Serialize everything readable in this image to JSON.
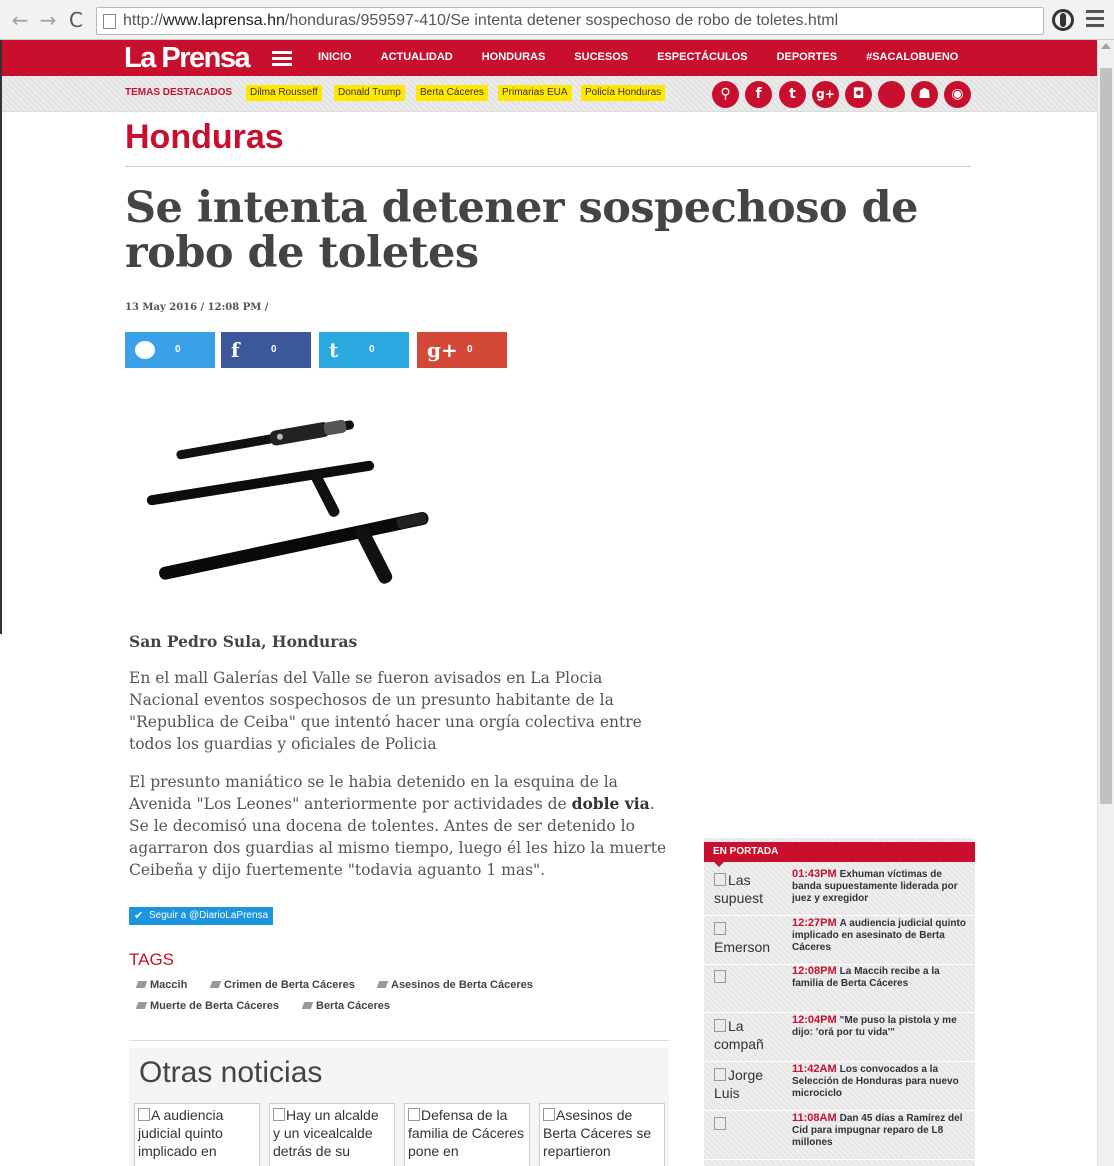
{
  "browser": {
    "url_prefix": "http://",
    "url_host": "www.laprensa.hn",
    "url_path": "/honduras/959597-410/Se intenta detener sospechoso de robo de toletes.html",
    "back": "←",
    "forward": "→",
    "reload": "C"
  },
  "site": {
    "logo": "La Prensa",
    "menu": [
      "INICIO",
      "ACTUALIDAD",
      "HONDURAS",
      "SUCESOS",
      "ESPECTÁCULOS",
      "DEPORTES",
      "#SACALOBUENO"
    ],
    "topics_label": "TEMAS DESTACADOS",
    "topics": [
      "Dilma Rousseff",
      "Donald Trump",
      "Berta Cáceres",
      "Primarias EUA",
      "Policía Honduras"
    ],
    "social_icons": [
      "search-icon",
      "facebook-icon",
      "twitter-icon",
      "googleplus-icon",
      "instagram-icon",
      "apple-icon",
      "android-icon",
      "rss-icon"
    ],
    "social_glyphs": [
      "⚲",
      "f",
      "t",
      "g+",
      "◘",
      "",
      "☗",
      "◉"
    ],
    "accent": "#c8102e",
    "highlight": "#ffe800"
  },
  "article": {
    "section": "Honduras",
    "headline": "Se intenta detener sospechoso de robo de toletes",
    "dateline": "13 May 2016 / 12:08 PM /",
    "share": [
      {
        "network": "comments",
        "count": "0",
        "color": "#3aa0e8"
      },
      {
        "network": "facebook",
        "glyph": "f",
        "count": "0",
        "color": "#3b5998"
      },
      {
        "network": "twitter",
        "glyph": "t",
        "count": "0",
        "color": "#2aa9e0"
      },
      {
        "network": "googleplus",
        "glyph": "g+",
        "count": "0",
        "color": "#d34836"
      }
    ],
    "location": "San Pedro Sula, Honduras",
    "p1": "En el mall Galerías del Valle se fueron avisados en La Plocia Nacional eventos sospechosos de un presunto habitante de la \"Republica de Ceiba\" que intentó hacer una orgía colectiva entre todos los guardias y oficiales de Policia",
    "p2_a": "El presunto maniático se le habia detenido en la esquina de la Avenida \"Los Leones\" anteriormente por actividades de ",
    "p2_bold": "doble via",
    "p2_b": ". Se le decomisó una docena de tolentes. Antes de ser detenido lo agarraron dos guardias al mismo tiempo, luego él les hizo la muerte Ceibeña y dijo fuertemente \"todavia aguanto 1 mas\".",
    "follow_button": "Seguir a @DiarioLaPrensa",
    "tags_title": "TAGS",
    "tags": [
      "Maccih",
      "Crimen de Berta Cáceres",
      "Asesinos de Berta Cáceres",
      "Muerte de Berta Cáceres",
      "Berta Cáceres"
    ]
  },
  "otras": {
    "title": "Otras noticias",
    "cards": [
      "A audiencia judicial quinto implicado en",
      "Hay un alcalde y un vicealcalde detrás de su",
      "Defensa de la familia de Cáceres pone en",
      "Asesinos de Berta Cáceres se repartieron"
    ]
  },
  "portada": {
    "title": "EN PORTADA",
    "items": [
      {
        "thumb_alt": "Las supuest",
        "time": "01:43PM",
        "text": "Exhuman víctimas de banda supuestamente liderada por juez y exregidor"
      },
      {
        "thumb_alt": "Emerson Eusebio",
        "time": "12:27PM",
        "text": "A audiencia judicial quinto implicado en asesinato de Berta Cáceres"
      },
      {
        "thumb_alt": "",
        "time": "12:08PM",
        "text": "La Maccih recibe a la familia de Berta Cáceres"
      },
      {
        "thumb_alt": "La compañ",
        "time": "12:04PM",
        "text": "\"Me puso la pistola y me dijo: 'orá por tu vida'\""
      },
      {
        "thumb_alt": "Jorge Luis",
        "time": "11:42AM",
        "text": "Los convocados a la Selección de Honduras para nuevo microciclo"
      },
      {
        "thumb_alt": "",
        "time": "11:08AM",
        "text": "Dan 45 días a Ramírez del Cid para impugnar reparo de L8 millones"
      }
    ]
  }
}
